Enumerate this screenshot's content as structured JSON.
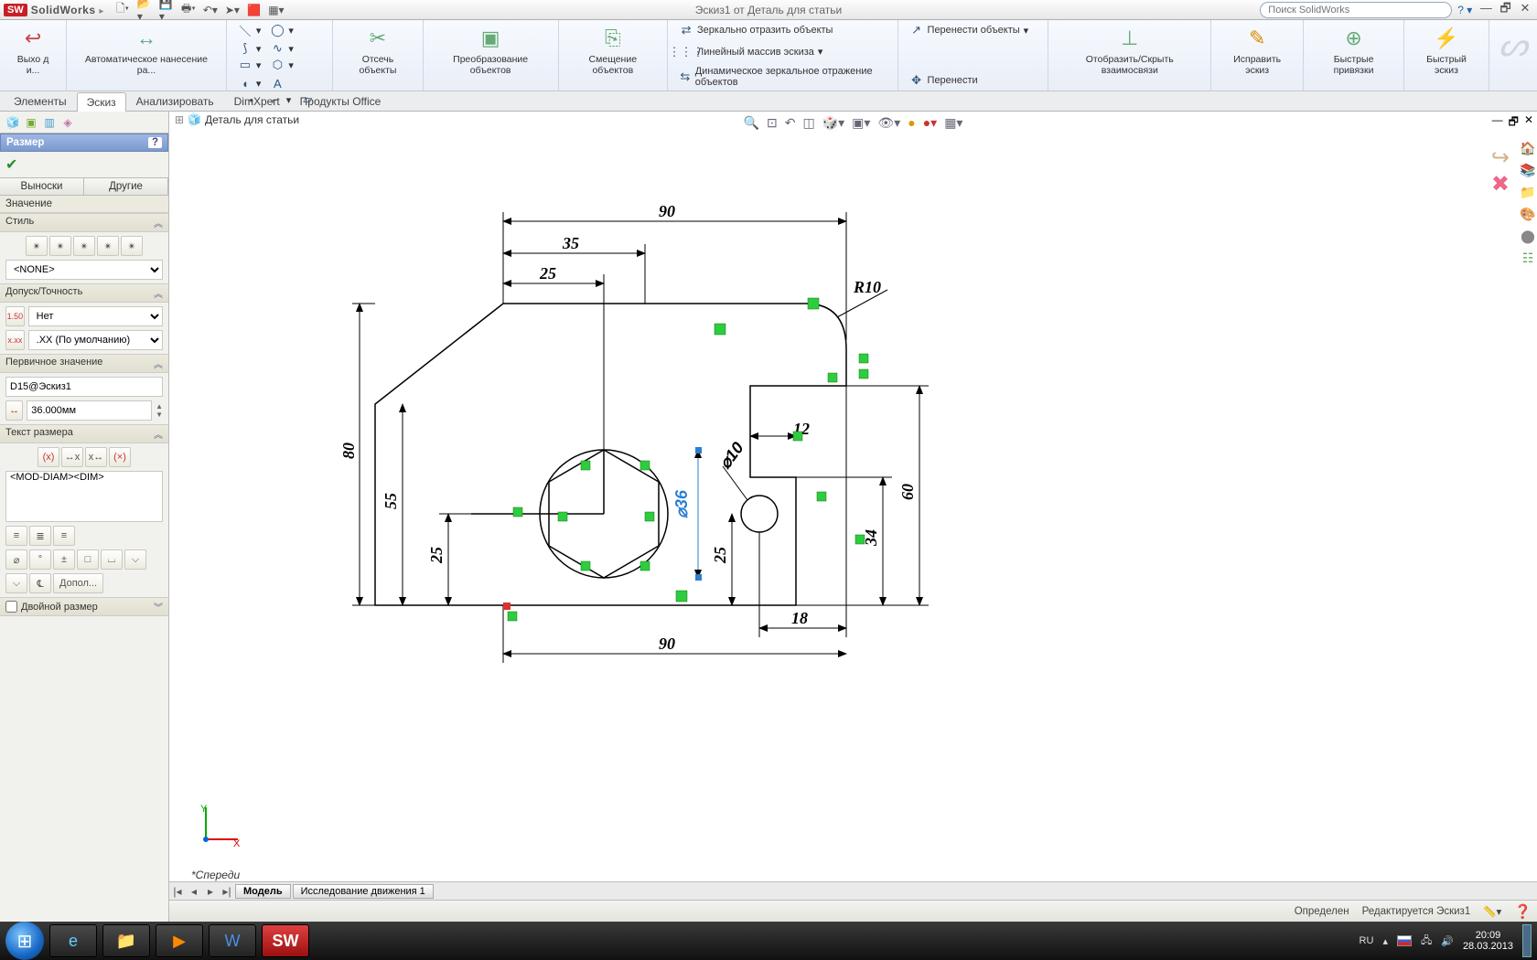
{
  "app": {
    "name": "SolidWorks",
    "logo_text": "SW"
  },
  "doc_title": "Эскиз1 от Деталь для статьи",
  "search_placeholder": "Поиск SolidWorks",
  "ribbon": {
    "exit": "Выхо д и...",
    "smart_dim": "Автоматическое нанесение ра...",
    "trim": "Отсечь объекты",
    "convert": "Преобразование объектов",
    "offset": "Смещение объектов",
    "mirror": "Зеркально отразить объекты",
    "linear": "Линейный массив эскиза",
    "move": "Перенести объекты",
    "dyn_mirror": "Динамическое зеркальное отражение объектов",
    "move2": "Перенести",
    "show_hide": "Отобразить/Скрыть взаимосвязи",
    "repair": "Исправить эскиз",
    "quick_snap": "Быстрые привязки",
    "rapid": "Быстрый эскиз"
  },
  "tabs": [
    "Элементы",
    "Эскиз",
    "Анализировать",
    "DimXpert",
    "Продукты Office"
  ],
  "active_tab": "Эскиз",
  "tree_root": "Деталь для статьи",
  "pm": {
    "title": "Размер",
    "tabs": [
      "Выноски",
      "Другие"
    ],
    "sub": "Значение",
    "sec_style": "Стиль",
    "style_dd": "<NONE>",
    "sec_tol": "Допуск/Точность",
    "tol_dd1": "Нет",
    "tol_dd2": ".XX (По умолчанию)",
    "sec_prim": "Первичное значение",
    "prim_name": "D15@Эскиз1",
    "prim_val": "36.000мм",
    "sec_text": "Текст размера",
    "dim_text": "<MOD-DIAM><DIM>",
    "more_btn": "Допол...",
    "dual": "Двойной размер"
  },
  "dims": {
    "d90a": "90",
    "d35": "35",
    "d25a": "25",
    "r10": "R10",
    "d12": "12",
    "d80": "80",
    "d55": "55",
    "d60": "60",
    "d36": "36",
    "d10": "10",
    "d25b": "25",
    "d25c": "25",
    "d34": "34",
    "d18": "18",
    "d90b": "90"
  },
  "view_label": "*Спереди",
  "btm_tabs": [
    "Модель",
    "Исследование движения 1"
  ],
  "status": {
    "defined": "Определен",
    "editing": "Редактируется Эскиз1"
  },
  "tray": {
    "lang": "RU",
    "time": "20:09",
    "date": "28.03.2013"
  }
}
